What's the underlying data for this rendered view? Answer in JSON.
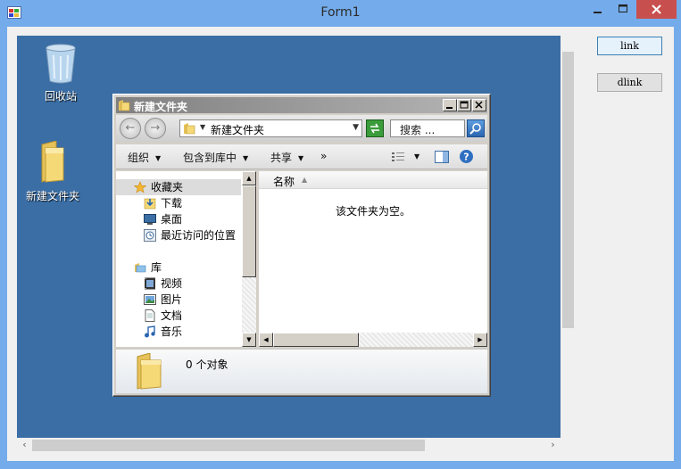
{
  "window": {
    "title": "Form1"
  },
  "buttons": {
    "link": "link",
    "dlink": "dlink"
  },
  "desktop": {
    "recycle_bin_label": "回收站",
    "new_folder_label": "新建文件夹"
  },
  "explorer": {
    "title": "新建文件夹",
    "address_path": "新建文件夹",
    "search_placeholder": "搜索 ...",
    "commands": {
      "organize": "组织",
      "include_in_library": "包含到库中",
      "share": "共享",
      "more": "»"
    },
    "nav": {
      "favorites": "收藏夹",
      "downloads": "下载",
      "desktop": "桌面",
      "recent": "最近访问的位置",
      "libraries": "库",
      "videos": "视频",
      "pictures": "图片",
      "documents": "文档",
      "music": "音乐"
    },
    "column_name": "名称",
    "empty_message": "该文件夹为空。",
    "item_count": "0 个对象"
  },
  "colors": {
    "desktop_bg": "#3a6ea5",
    "titlebar": "#74abea",
    "close": "#c7504e"
  }
}
